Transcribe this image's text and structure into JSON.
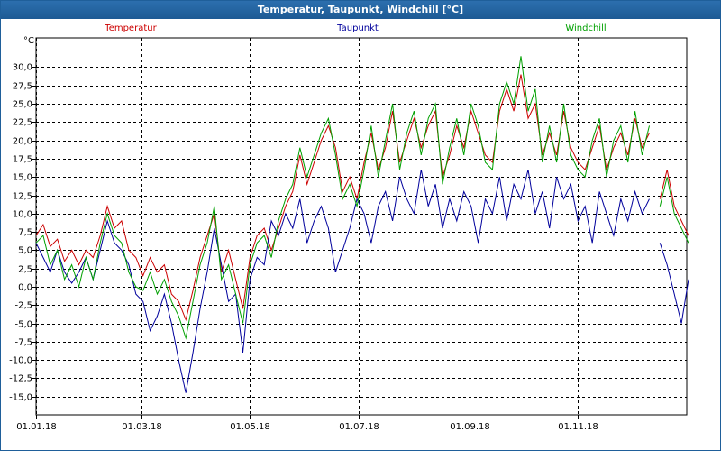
{
  "window": {
    "title": "Temperatur, Taupunkt, Windchill [°C]"
  },
  "chart_data": {
    "type": "line",
    "title": "Temperatur, Taupunkt, Windchill [°C]",
    "ylabel": "°C",
    "xlabel": "",
    "ylim": [
      -17.5,
      34
    ],
    "y_ticks": [
      -15.0,
      -12.5,
      -10.0,
      -7.5,
      -5.0,
      -2.5,
      0.0,
      2.5,
      5.0,
      7.5,
      10.0,
      12.5,
      15.0,
      17.5,
      20.0,
      22.5,
      25.0,
      27.5,
      30.0
    ],
    "y_tick_labels": [
      "-15,0",
      "-12,5",
      "-10,0",
      "-7,5",
      "-5,0",
      "-2,5",
      "0,0",
      "2,5",
      "5,0",
      "7,5",
      "10,0",
      "12,5",
      "15,0",
      "17,5",
      "20,0",
      "22,5",
      "25,0",
      "27,5",
      "30,0"
    ],
    "x_tick_labels": [
      "01.01.18",
      "01.03.18",
      "01.05.18",
      "01.07.18",
      "01.09.18",
      "01.11.18"
    ],
    "x_tick_days": [
      0,
      59,
      120,
      181,
      243,
      304
    ],
    "x_range_days": [
      0,
      365
    ],
    "grid": true,
    "legend_position": "top",
    "series": [
      {
        "name": "Temperatur",
        "color": "#cc0000",
        "points": [
          [
            0,
            7
          ],
          [
            4,
            8.5
          ],
          [
            8,
            5.5
          ],
          [
            12,
            6.5
          ],
          [
            16,
            3.5
          ],
          [
            20,
            5
          ],
          [
            24,
            3
          ],
          [
            28,
            5
          ],
          [
            32,
            4
          ],
          [
            36,
            7
          ],
          [
            40,
            11
          ],
          [
            44,
            8
          ],
          [
            48,
            9
          ],
          [
            52,
            5
          ],
          [
            56,
            4
          ],
          [
            60,
            1.5
          ],
          [
            64,
            4
          ],
          [
            68,
            2
          ],
          [
            72,
            3
          ],
          [
            76,
            -1
          ],
          [
            80,
            -2
          ],
          [
            84,
            -4.5
          ],
          [
            88,
            -0.5
          ],
          [
            92,
            4
          ],
          [
            96,
            7
          ],
          [
            100,
            10
          ],
          [
            104,
            2
          ],
          [
            108,
            5
          ],
          [
            112,
            1
          ],
          [
            116,
            -3
          ],
          [
            120,
            4
          ],
          [
            124,
            7
          ],
          [
            128,
            8
          ],
          [
            132,
            5
          ],
          [
            136,
            8
          ],
          [
            140,
            11
          ],
          [
            144,
            13
          ],
          [
            148,
            18
          ],
          [
            152,
            14
          ],
          [
            156,
            17
          ],
          [
            160,
            20
          ],
          [
            164,
            22
          ],
          [
            168,
            19
          ],
          [
            172,
            13
          ],
          [
            176,
            15
          ],
          [
            180,
            12
          ],
          [
            184,
            17
          ],
          [
            188,
            21
          ],
          [
            192,
            16
          ],
          [
            196,
            19
          ],
          [
            200,
            24
          ],
          [
            204,
            17
          ],
          [
            208,
            20
          ],
          [
            212,
            23
          ],
          [
            216,
            19
          ],
          [
            220,
            22
          ],
          [
            224,
            24
          ],
          [
            228,
            15
          ],
          [
            232,
            18
          ],
          [
            236,
            22
          ],
          [
            240,
            19
          ],
          [
            244,
            24
          ],
          [
            248,
            21
          ],
          [
            252,
            18
          ],
          [
            256,
            17
          ],
          [
            260,
            24
          ],
          [
            264,
            27
          ],
          [
            268,
            24
          ],
          [
            272,
            29
          ],
          [
            276,
            23
          ],
          [
            280,
            25
          ],
          [
            284,
            18
          ],
          [
            288,
            21
          ],
          [
            292,
            18
          ],
          [
            296,
            24
          ],
          [
            300,
            19
          ],
          [
            304,
            17
          ],
          [
            308,
            16
          ],
          [
            312,
            19
          ],
          [
            316,
            22
          ],
          [
            320,
            16
          ],
          [
            324,
            19
          ],
          [
            328,
            21
          ],
          [
            332,
            18
          ],
          [
            336,
            23
          ],
          [
            340,
            19
          ],
          [
            344,
            21
          ],
          [
            350,
            12
          ],
          [
            354,
            16
          ],
          [
            358,
            11
          ],
          [
            362,
            9
          ],
          [
            366,
            7
          ]
        ],
        "gaps_after_day": [
          344
        ]
      },
      {
        "name": "Taupunkt",
        "color": "#00009c",
        "points": [
          [
            0,
            6
          ],
          [
            4,
            4
          ],
          [
            8,
            2
          ],
          [
            12,
            5
          ],
          [
            16,
            2
          ],
          [
            20,
            0.5
          ],
          [
            24,
            2
          ],
          [
            28,
            4
          ],
          [
            32,
            1
          ],
          [
            36,
            5
          ],
          [
            40,
            9
          ],
          [
            44,
            6
          ],
          [
            48,
            5
          ],
          [
            52,
            3
          ],
          [
            56,
            -1
          ],
          [
            60,
            -2
          ],
          [
            64,
            -6
          ],
          [
            68,
            -4
          ],
          [
            72,
            -1
          ],
          [
            76,
            -5
          ],
          [
            80,
            -10
          ],
          [
            84,
            -14.5
          ],
          [
            88,
            -9
          ],
          [
            92,
            -3
          ],
          [
            96,
            2
          ],
          [
            100,
            8
          ],
          [
            104,
            3
          ],
          [
            108,
            -2
          ],
          [
            112,
            -1
          ],
          [
            116,
            -9
          ],
          [
            120,
            1
          ],
          [
            124,
            4
          ],
          [
            128,
            3
          ],
          [
            132,
            9
          ],
          [
            136,
            7
          ],
          [
            140,
            10
          ],
          [
            144,
            8
          ],
          [
            148,
            12
          ],
          [
            152,
            6
          ],
          [
            156,
            9
          ],
          [
            160,
            11
          ],
          [
            164,
            8
          ],
          [
            168,
            2
          ],
          [
            172,
            5
          ],
          [
            176,
            8
          ],
          [
            180,
            12
          ],
          [
            184,
            10
          ],
          [
            188,
            6
          ],
          [
            192,
            11
          ],
          [
            196,
            13
          ],
          [
            200,
            9
          ],
          [
            204,
            15
          ],
          [
            208,
            12
          ],
          [
            212,
            10
          ],
          [
            216,
            16
          ],
          [
            220,
            11
          ],
          [
            224,
            14
          ],
          [
            228,
            8
          ],
          [
            232,
            12
          ],
          [
            236,
            9
          ],
          [
            240,
            13
          ],
          [
            244,
            11
          ],
          [
            248,
            6
          ],
          [
            252,
            12
          ],
          [
            256,
            10
          ],
          [
            260,
            15
          ],
          [
            264,
            9
          ],
          [
            268,
            14
          ],
          [
            272,
            12
          ],
          [
            276,
            16
          ],
          [
            280,
            10
          ],
          [
            284,
            13
          ],
          [
            288,
            8
          ],
          [
            292,
            15
          ],
          [
            296,
            12
          ],
          [
            300,
            14
          ],
          [
            304,
            9
          ],
          [
            308,
            11
          ],
          [
            312,
            6
          ],
          [
            316,
            13
          ],
          [
            320,
            10
          ],
          [
            324,
            7
          ],
          [
            328,
            12
          ],
          [
            332,
            9
          ],
          [
            336,
            13
          ],
          [
            340,
            10
          ],
          [
            344,
            12
          ],
          [
            350,
            6
          ],
          [
            354,
            3
          ],
          [
            358,
            -1
          ],
          [
            362,
            -5
          ],
          [
            366,
            1
          ]
        ],
        "gaps_after_day": [
          344
        ]
      },
      {
        "name": "Windchill",
        "color": "#00a000",
        "points": [
          [
            0,
            6
          ],
          [
            4,
            7
          ],
          [
            8,
            3
          ],
          [
            12,
            5
          ],
          [
            16,
            1
          ],
          [
            20,
            3
          ],
          [
            24,
            0
          ],
          [
            28,
            4
          ],
          [
            32,
            1
          ],
          [
            36,
            6
          ],
          [
            40,
            10
          ],
          [
            44,
            7
          ],
          [
            48,
            6
          ],
          [
            52,
            2
          ],
          [
            56,
            0
          ],
          [
            60,
            -0.5
          ],
          [
            64,
            2
          ],
          [
            68,
            -1
          ],
          [
            72,
            1
          ],
          [
            76,
            -2
          ],
          [
            80,
            -4
          ],
          [
            84,
            -7
          ],
          [
            88,
            -2
          ],
          [
            92,
            3
          ],
          [
            96,
            6
          ],
          [
            100,
            11
          ],
          [
            104,
            1
          ],
          [
            108,
            3
          ],
          [
            112,
            -1
          ],
          [
            116,
            -5
          ],
          [
            120,
            3
          ],
          [
            124,
            6
          ],
          [
            128,
            7
          ],
          [
            132,
            4
          ],
          [
            136,
            9
          ],
          [
            140,
            12
          ],
          [
            144,
            14
          ],
          [
            148,
            19
          ],
          [
            152,
            15
          ],
          [
            156,
            18
          ],
          [
            160,
            21
          ],
          [
            164,
            23
          ],
          [
            168,
            18
          ],
          [
            172,
            12
          ],
          [
            176,
            14
          ],
          [
            180,
            11
          ],
          [
            184,
            16
          ],
          [
            188,
            22
          ],
          [
            192,
            15
          ],
          [
            196,
            20
          ],
          [
            200,
            25
          ],
          [
            204,
            16
          ],
          [
            208,
            21
          ],
          [
            212,
            24
          ],
          [
            216,
            18
          ],
          [
            220,
            23
          ],
          [
            224,
            25
          ],
          [
            228,
            14
          ],
          [
            232,
            19
          ],
          [
            236,
            23
          ],
          [
            240,
            18
          ],
          [
            244,
            25
          ],
          [
            248,
            22
          ],
          [
            252,
            17
          ],
          [
            256,
            16
          ],
          [
            260,
            25
          ],
          [
            264,
            28
          ],
          [
            268,
            25
          ],
          [
            272,
            31.5
          ],
          [
            276,
            24
          ],
          [
            280,
            27
          ],
          [
            284,
            17
          ],
          [
            288,
            22
          ],
          [
            292,
            17
          ],
          [
            296,
            25
          ],
          [
            300,
            18
          ],
          [
            304,
            16
          ],
          [
            308,
            15
          ],
          [
            312,
            20
          ],
          [
            316,
            23
          ],
          [
            320,
            15
          ],
          [
            324,
            20
          ],
          [
            328,
            22
          ],
          [
            332,
            17
          ],
          [
            336,
            24
          ],
          [
            340,
            18
          ],
          [
            344,
            22
          ],
          [
            350,
            11
          ],
          [
            354,
            15
          ],
          [
            358,
            10
          ],
          [
            362,
            8
          ],
          [
            366,
            6
          ]
        ],
        "gaps_after_day": [
          344
        ]
      }
    ]
  }
}
